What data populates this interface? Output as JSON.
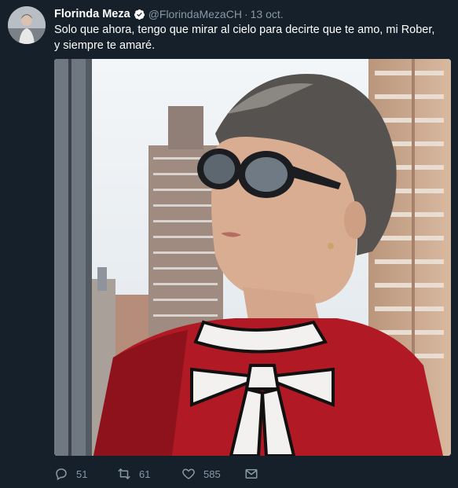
{
  "user": {
    "name": "Florinda Meza",
    "handle": "@FlorindaMezaCH",
    "separator": "·",
    "date": "13 oct."
  },
  "tweet": {
    "text": "Solo que ahora, tengo que mirar al cielo para decirte que te amo, mi Rober, y siempre te amaré."
  },
  "actions": {
    "replies": "51",
    "retweets": "61",
    "likes": "585"
  },
  "icons": {
    "verified": "verified-badge-icon",
    "reply": "reply-icon",
    "retweet": "retweet-icon",
    "like": "heart-icon",
    "message": "envelope-icon"
  },
  "colors": {
    "background": "#15202b",
    "secondary_text": "#8899a6",
    "verified_badge": "#ffffff"
  }
}
